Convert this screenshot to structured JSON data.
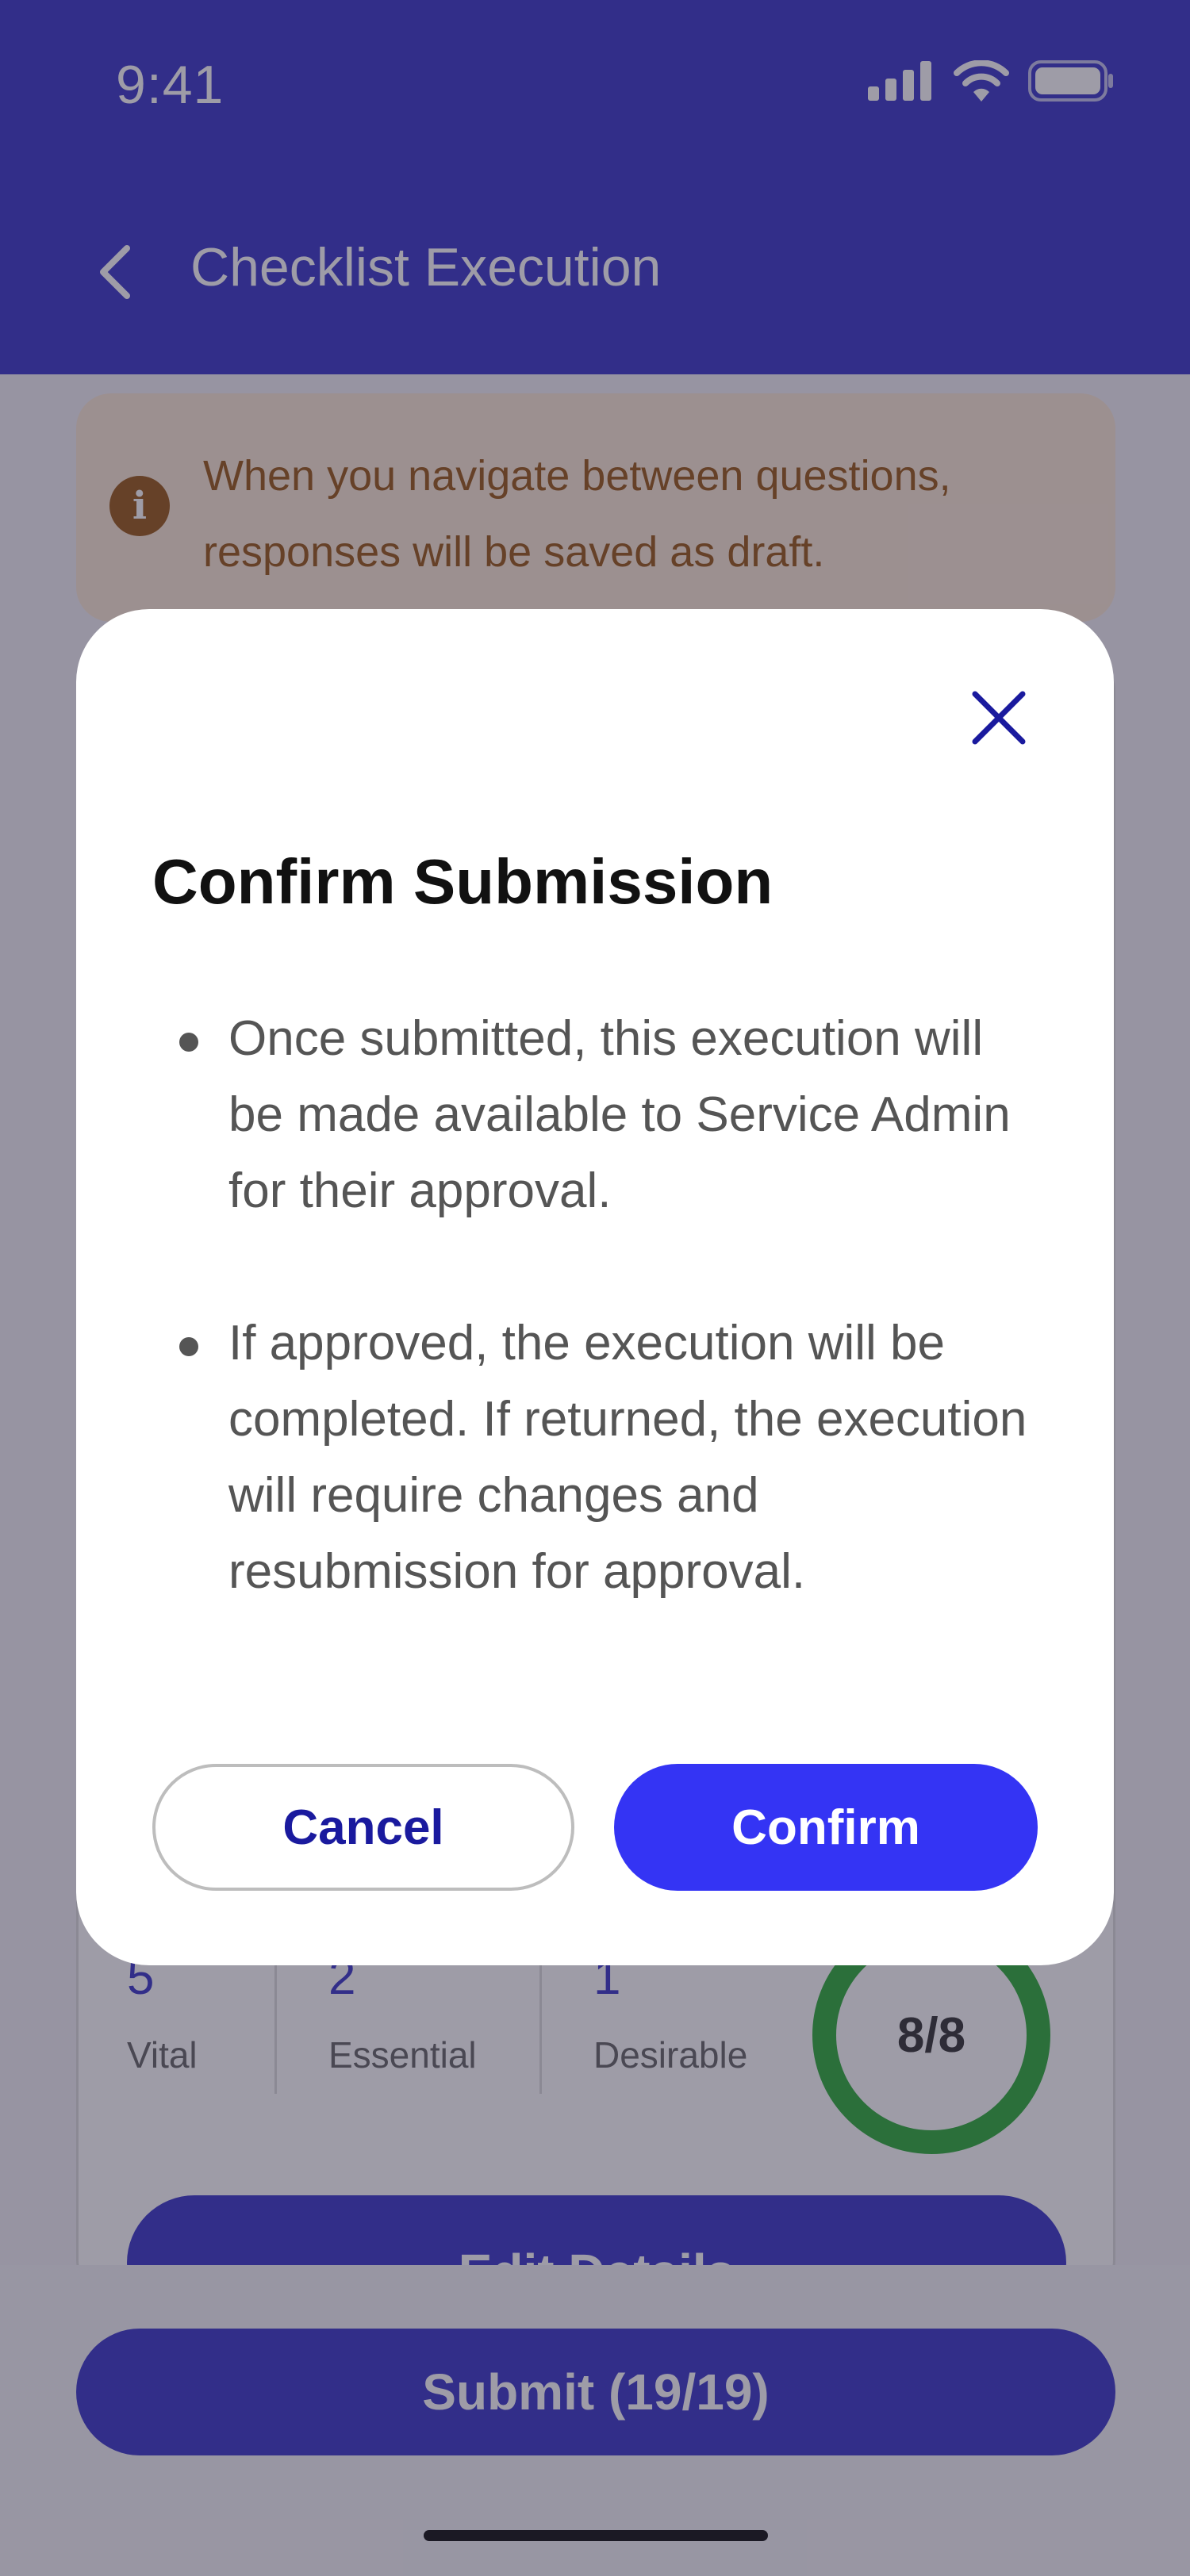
{
  "status_bar": {
    "time": "9:41"
  },
  "header": {
    "title": "Checklist Execution"
  },
  "info_banner": {
    "text": "When you navigate between questions, responses will be saved as draft."
  },
  "summary": {
    "stats": [
      {
        "count": "5",
        "label": "Vital"
      },
      {
        "count": "2",
        "label": "Essential"
      },
      {
        "count": "1",
        "label": "Desirable"
      }
    ],
    "progress_text": "8/8",
    "progress_fraction": 1.0,
    "edit_button": "Edit Details"
  },
  "footer": {
    "submit_button": "Submit (19/19)"
  },
  "modal": {
    "title": "Confirm Submission",
    "bullets": [
      "Once submitted, this execution will be made available to Service Admin for their approval.",
      "If approved, the execution will be completed. If returned, the execution will require changes and resubmission for approval."
    ],
    "cancel_button": "Cancel",
    "confirm_button": "Confirm"
  },
  "colors": {
    "header": "#3b37c9",
    "primary_button": "#3434f4",
    "info_text": "#9a5a18",
    "progress_ring": "#2fae3a"
  },
  "icons": [
    "cellular-signal-icon",
    "wifi-icon",
    "battery-icon",
    "chevron-left-icon",
    "info-icon",
    "close-icon"
  ]
}
